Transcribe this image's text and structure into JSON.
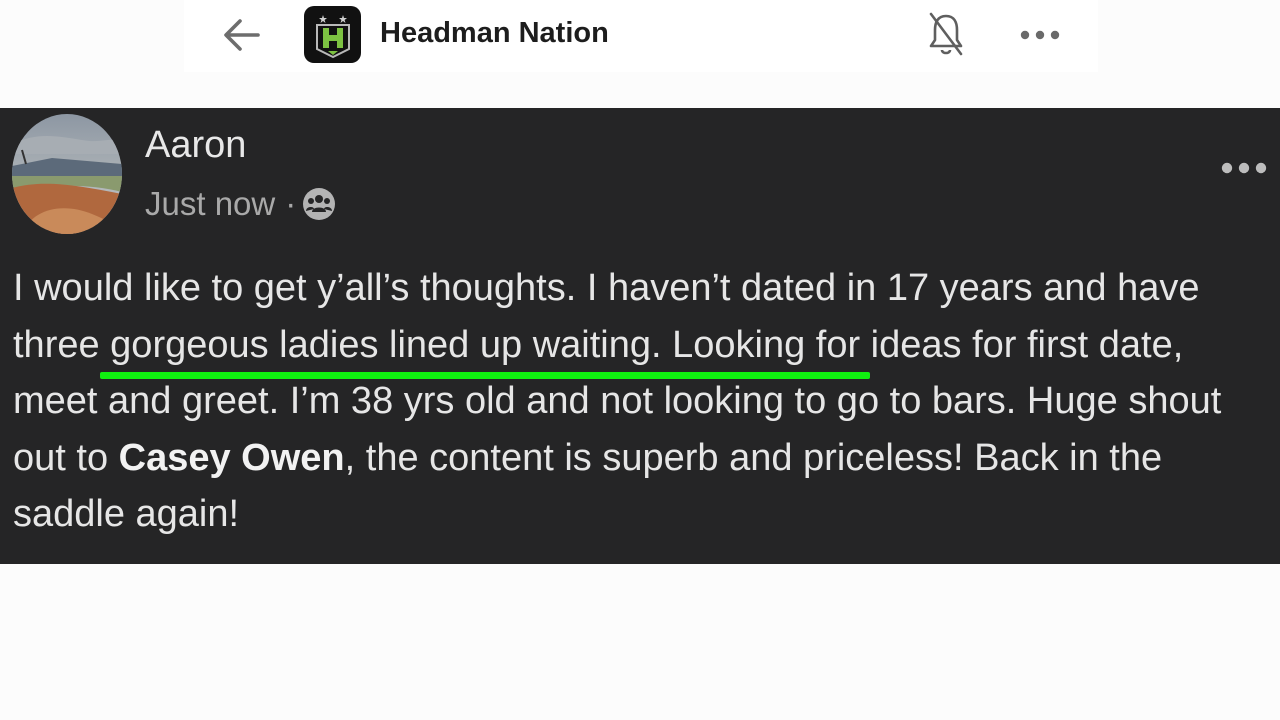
{
  "header": {
    "back_icon": "arrow-left-icon",
    "app_icon": "headman-nation-logo",
    "title": "Headman Nation",
    "bell_icon": "bell-off-icon",
    "more_icon": "more-horizontal-icon"
  },
  "post": {
    "author": "Aaron",
    "timestamp": "Just now",
    "separator": "·",
    "audience_icon": "group-audience-icon",
    "more_icon": "more-horizontal-icon",
    "body_part1": "I would like to get y’all’s thoughts. I haven’t dated in 17 years and have three gorgeous ladies lined up waiting. Looking for ideas for first date, meet and greet. I’m 38 yrs old and not looking to go to bars. Huge shout out to ",
    "mention": "Casey Owen",
    "body_part2": ", the content is superb and priceless! Back in the saddle again!",
    "highlight_color": "#10f010"
  },
  "colors": {
    "post_background": "#252526",
    "post_text": "#e6e6e6",
    "meta_text": "#a9a9a9",
    "header_background": "#ffffff"
  }
}
